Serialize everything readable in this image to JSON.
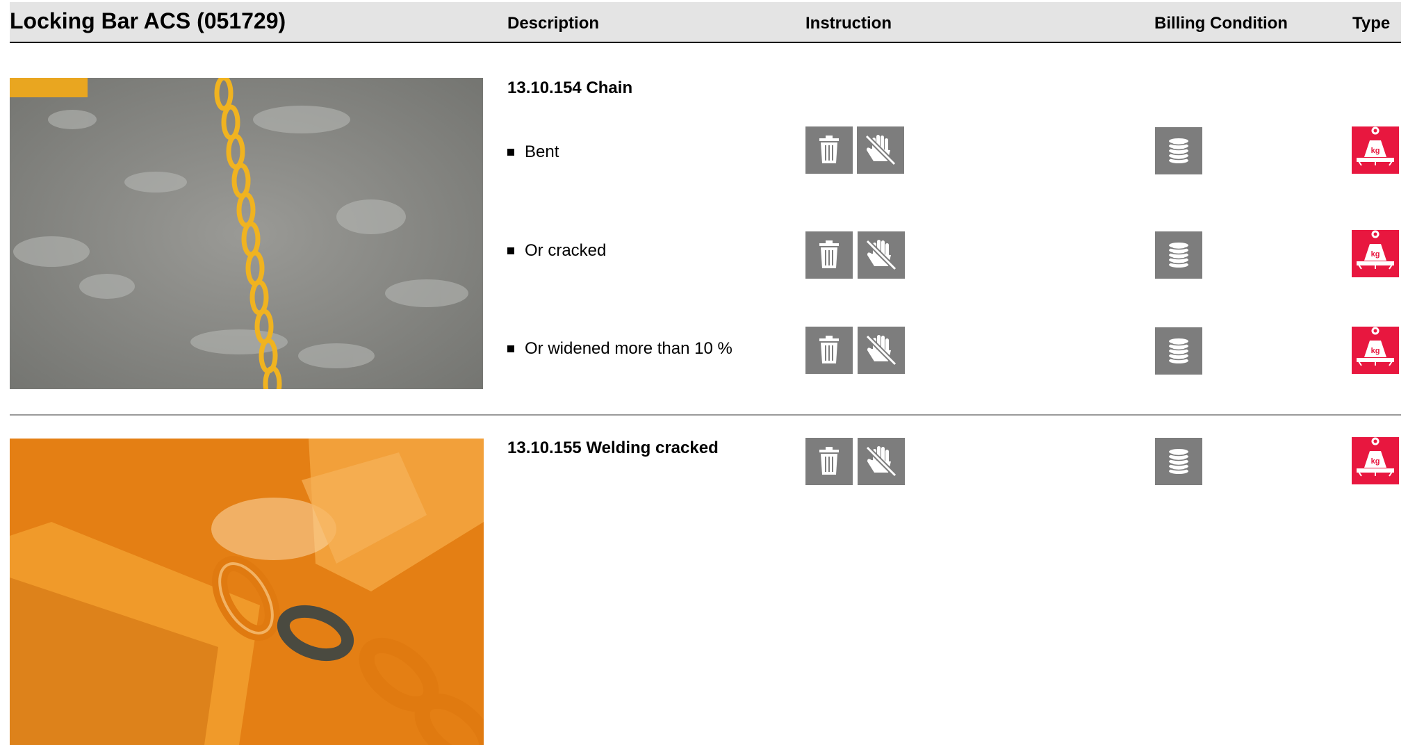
{
  "header": {
    "title": "Locking Bar ACS (051729)",
    "columns": {
      "description": "Description",
      "instruction": "Instruction",
      "billing": "Billing Condition",
      "type": "Type"
    }
  },
  "sections": [
    {
      "title": "13.10.154 Chain",
      "items": [
        {
          "label": "Bent"
        },
        {
          "label": "Or cracked"
        },
        {
          "label": "Or widened more than 10 %"
        }
      ]
    },
    {
      "title": "13.10.155 Welding cracked",
      "items": []
    }
  ],
  "icons": {
    "instruction": [
      "trash-icon",
      "no-hand-icon"
    ],
    "billing": "coin-stack-icon",
    "type": "weight-kg-icon",
    "weight_text": "kg"
  },
  "colors": {
    "header_bg": "#e4e4e4",
    "icon_grey": "#7d7d7d",
    "icon_red": "#e8173f",
    "chain_yellow": "#f0b320",
    "panel_orange": "#e98a1e"
  }
}
